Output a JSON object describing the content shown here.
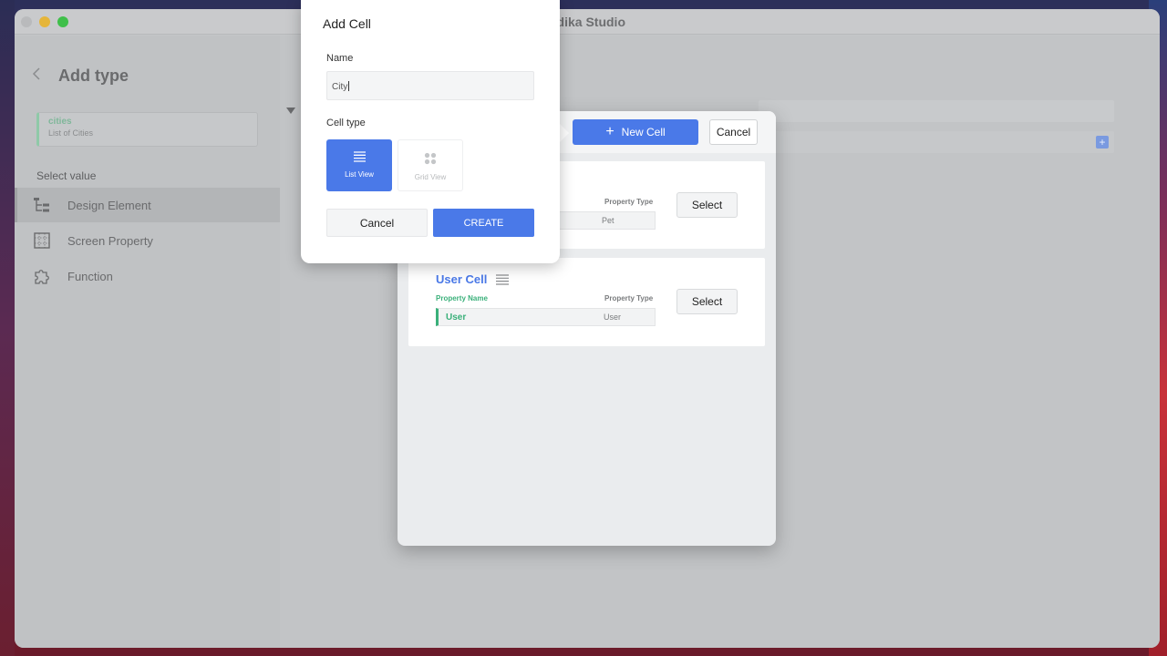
{
  "window": {
    "app_title": "odika Studio"
  },
  "sidebar": {
    "title": "Add type",
    "type_card": {
      "name": "cities",
      "description": "List of Cities"
    },
    "section_label": "Select value",
    "items": [
      {
        "label": "Design Element",
        "icon": "tree-structure-icon",
        "active": true
      },
      {
        "label": "Screen Property",
        "icon": "grid-box-icon",
        "active": false
      },
      {
        "label": "Function",
        "icon": "puzzle-icon",
        "active": false
      }
    ]
  },
  "picker": {
    "new_cell_label": "New Cell",
    "cancel_label": "Cancel",
    "cells": [
      {
        "name": "",
        "property_name_header": "",
        "property_type_header": "Property Type",
        "property_name": "",
        "property_type": "Pet",
        "select_label": "Select"
      },
      {
        "name": "User Cell",
        "property_name_header": "Property Name",
        "property_type_header": "Property Type",
        "property_name": "User",
        "property_type": "User",
        "select_label": "Select"
      }
    ]
  },
  "add_cell": {
    "title": "Add Cell",
    "name_label": "Name",
    "name_value": "City",
    "cell_type_label": "Cell type",
    "options": [
      {
        "label": "List View",
        "selected": true,
        "icon": "list-icon"
      },
      {
        "label": "Grid View",
        "selected": false,
        "icon": "grid-icon"
      }
    ],
    "cancel_label": "Cancel",
    "create_label": "CREATE"
  },
  "colors": {
    "accent": "#4a79e8",
    "green": "#3ab07a"
  }
}
